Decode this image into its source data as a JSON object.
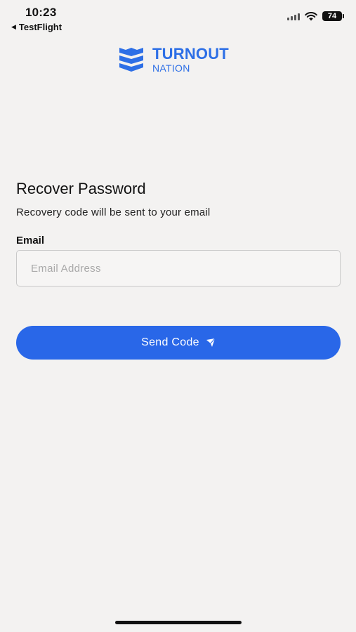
{
  "status_bar": {
    "time": "10:23",
    "back_app": "TestFlight",
    "battery_level": "74",
    "icons": [
      "back-arrow-icon",
      "signal-icon",
      "wifi-icon",
      "battery-icon"
    ]
  },
  "logo": {
    "title": "TURNOUT",
    "subtitle": "NATION",
    "color": "#2d6fe6",
    "icon": "shield-stripes-icon"
  },
  "recover": {
    "title": "Recover Password",
    "subtitle": "Recovery code will be sent to your email",
    "email_label": "Email",
    "email_placeholder": "Email Address",
    "email_value": "",
    "send_button_label": "Send Code",
    "send_button_icon": "paper-plane-icon",
    "accent_color": "#2967e8"
  }
}
